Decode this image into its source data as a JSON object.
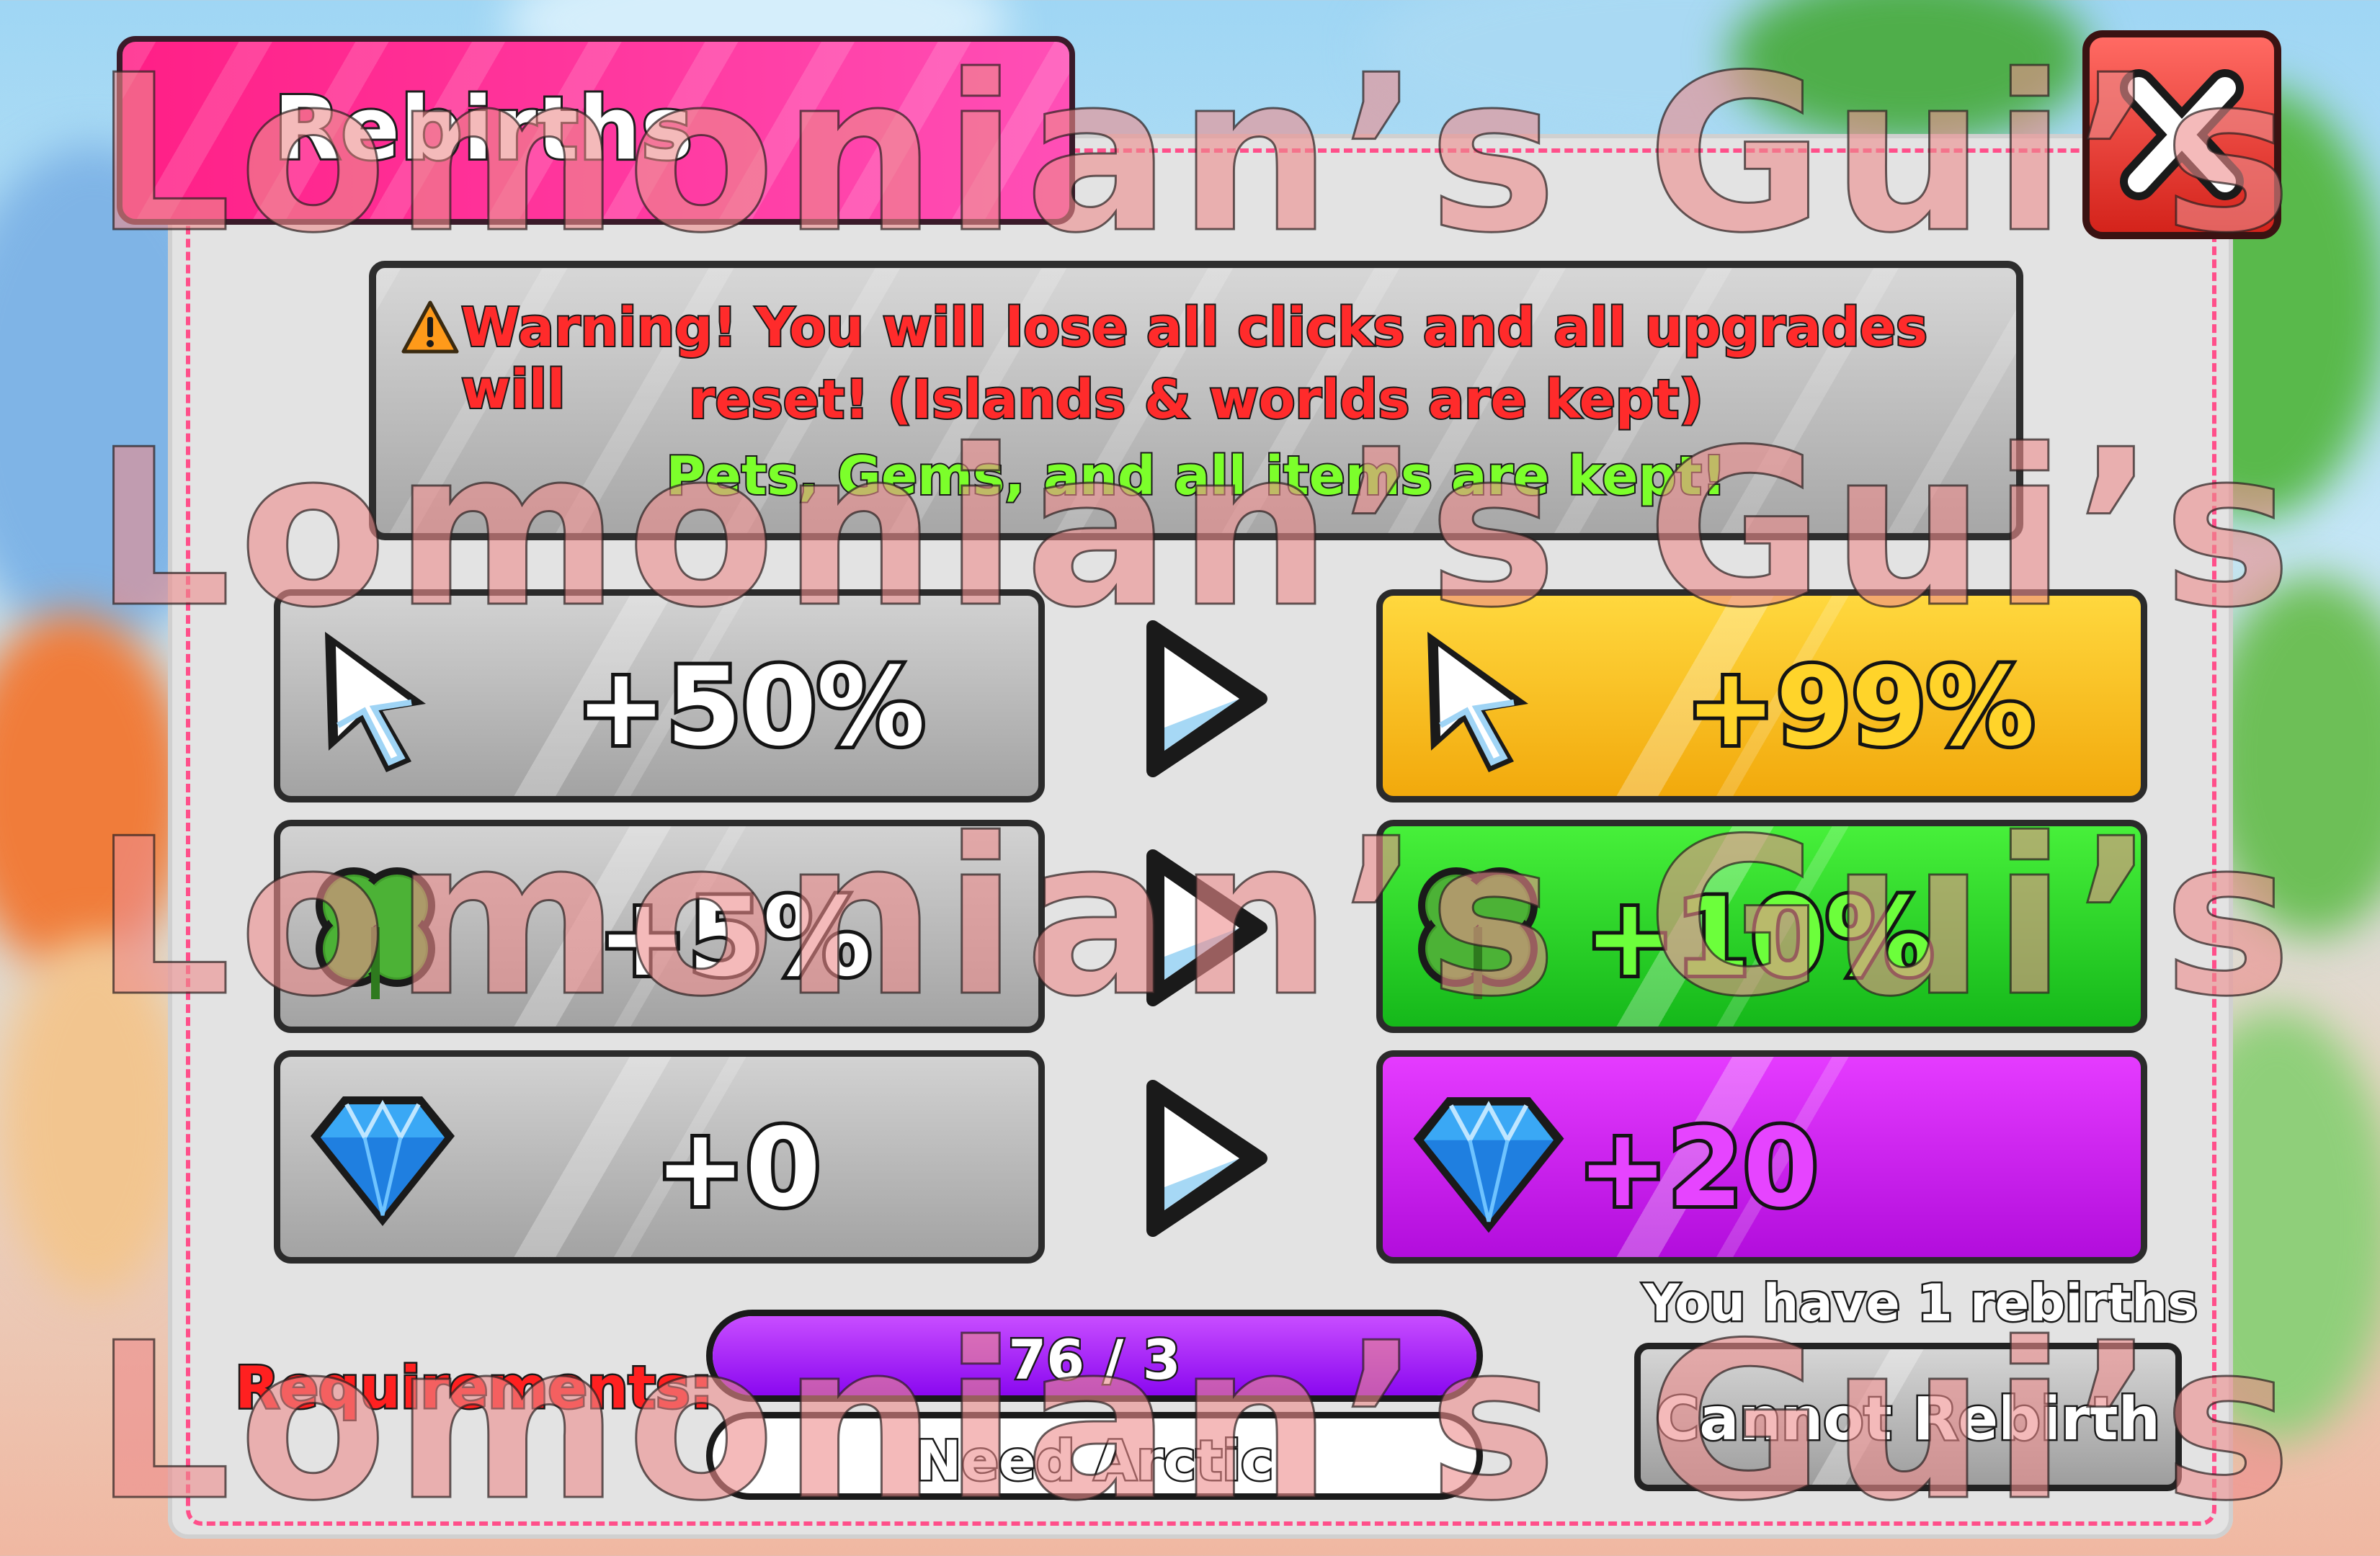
{
  "window": {
    "title": "Rebirths"
  },
  "warning": {
    "line1": "Warning! You will lose all clicks and all upgrades will",
    "line2": "reset! (Islands & worlds are kept)",
    "line3": "Pets, Gems, and all items are kept!"
  },
  "stats": {
    "clicks": {
      "current": "+50%",
      "next": "+99%"
    },
    "luck": {
      "current": "+5%",
      "next": "+10%"
    },
    "gems": {
      "current": "+0",
      "next": "+20"
    }
  },
  "requirements": {
    "label": "Requirements:",
    "progress_text": "76 / 3",
    "progress_fraction": 1.0,
    "need_text": "Need Arctic"
  },
  "rebirth": {
    "count_text": "You have 1 rebirths",
    "button_label": "Cannot Rebirth"
  },
  "watermark": {
    "text": "Lomonian’s Gui’s"
  },
  "colors": {
    "title_bar": "#ff1f86",
    "close": "#e0322a",
    "warning_red": "#ff2b2b",
    "kept_green": "#7cff2b",
    "clicks_next": "#ffd42a",
    "luck_next": "#2fd62b",
    "gems_next": "#d11cf0",
    "progress_fill": "#a020f0"
  },
  "icons": {
    "clicks": "cursor-icon",
    "luck": "clover-icon",
    "gems": "diamond-icon",
    "transition": "play-arrow-icon",
    "warning": "warning-icon",
    "close": "close-icon"
  }
}
